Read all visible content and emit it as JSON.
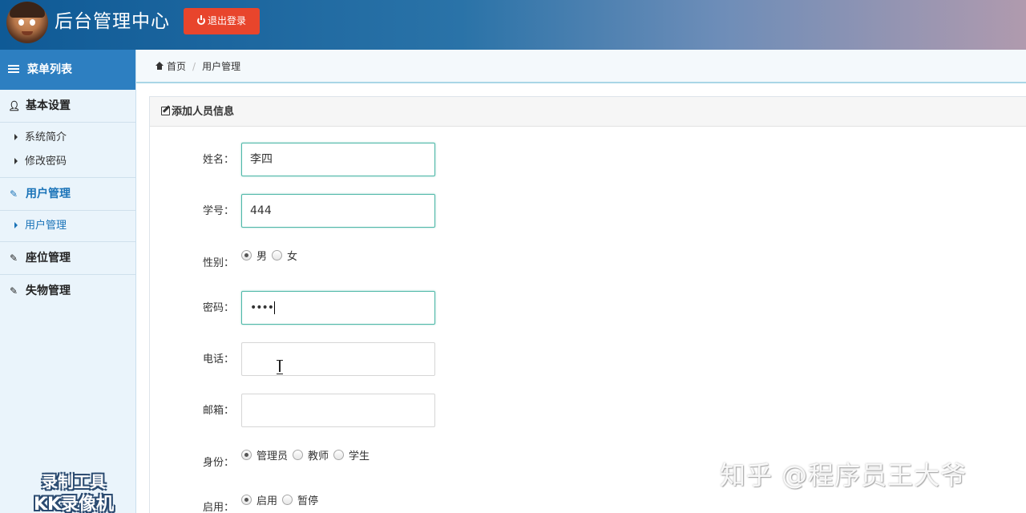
{
  "header": {
    "app_title": "后台管理中心",
    "logout_label": "退出登录"
  },
  "sidebar": {
    "menu_title": "菜单列表",
    "groups": [
      {
        "label": "基本设置",
        "icon": "user-icon",
        "items": [
          "系统简介",
          "修改密码"
        ]
      },
      {
        "label": "用户管理",
        "icon": "edit-icon",
        "items": [
          "用户管理"
        ]
      },
      {
        "label": "座位管理",
        "icon": "edit-icon",
        "items": []
      },
      {
        "label": "失物管理",
        "icon": "edit-icon",
        "items": []
      }
    ],
    "active_group": "用户管理",
    "active_item": "用户管理"
  },
  "breadcrumb": {
    "home": "首页",
    "current": "用户管理"
  },
  "form": {
    "panel_title": "添加人员信息",
    "name": {
      "label": "姓名：",
      "value": "李四"
    },
    "student_id": {
      "label": "学号：",
      "value": "444"
    },
    "gender": {
      "label": "性别：",
      "options": [
        "男",
        "女"
      ],
      "selected": "男"
    },
    "password": {
      "label": "密码：",
      "value": "••••"
    },
    "phone": {
      "label": "电话：",
      "value": ""
    },
    "email": {
      "label": "邮箱：",
      "value": ""
    },
    "role": {
      "label": "身份：",
      "options": [
        "管理员",
        "教师",
        "学生"
      ],
      "selected": "管理员"
    },
    "enabled": {
      "label": "启用：",
      "options": [
        "启用",
        "暂停"
      ],
      "selected": "启用"
    }
  },
  "watermarks": {
    "recorder_line1": "录制工具",
    "recorder_line2": "KK录像机",
    "zhihu": "知乎 @程序员王大爷"
  },
  "colors": {
    "header_start": "#0f5a96",
    "menu_head": "#2d7fc1",
    "logout": "#e8452c",
    "active_link": "#1a73b8",
    "focus_border": "#4fb8a8"
  }
}
